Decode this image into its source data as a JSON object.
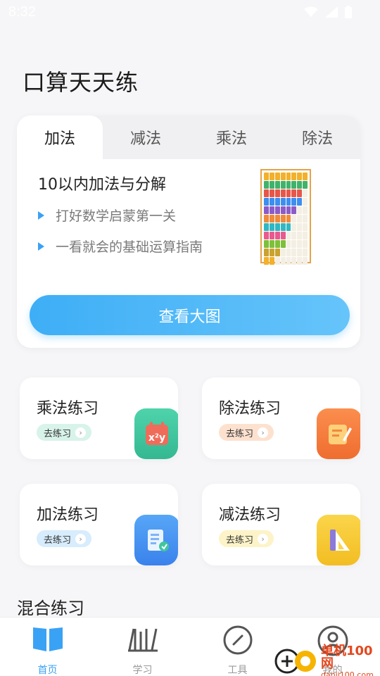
{
  "status": {
    "time": "8:32"
  },
  "page": {
    "title": "口算天天练"
  },
  "tabs": [
    {
      "label": "加法",
      "active": true
    },
    {
      "label": "减法",
      "active": false
    },
    {
      "label": "乘法",
      "active": false
    },
    {
      "label": "除法",
      "active": false
    }
  ],
  "main_card": {
    "heading": "10以内加法与分解",
    "bullets": [
      "打好数学启蒙第一关",
      "一看就会的基础运算指南"
    ],
    "button_label": "查看大图"
  },
  "practice": [
    {
      "title": "乘法练习",
      "go_label": "去练习",
      "pill_color": "#d8f3ea",
      "icon": "calendar-xy-icon",
      "icon_color": "#3fc6a0"
    },
    {
      "title": "除法练习",
      "go_label": "去练习",
      "pill_color": "#fde1cf",
      "icon": "note-pencil-icon",
      "icon_color": "#f47a3c"
    },
    {
      "title": "加法练习",
      "go_label": "去练习",
      "pill_color": "#d7ecfc",
      "icon": "document-check-icon",
      "icon_color": "#3d8ef0"
    },
    {
      "title": "减法练习",
      "go_label": "去练习",
      "pill_color": "#fdf3c8",
      "icon": "ruler-triangle-icon",
      "icon_color": "#f5c62b"
    }
  ],
  "mixed": {
    "title": "混合练习"
  },
  "nav": {
    "accent": "#3aa2f5",
    "items": [
      {
        "icon": "book-icon",
        "label": "首页",
        "active": true
      },
      {
        "icon": "bookshelf-icon",
        "label": "学习",
        "active": false
      },
      {
        "icon": "compass-icon",
        "label": "工具",
        "active": false
      },
      {
        "icon": "user-icon",
        "label": "我的",
        "active": false
      }
    ]
  },
  "watermark": {
    "brand": "单机100网",
    "url": "danji100.com"
  }
}
